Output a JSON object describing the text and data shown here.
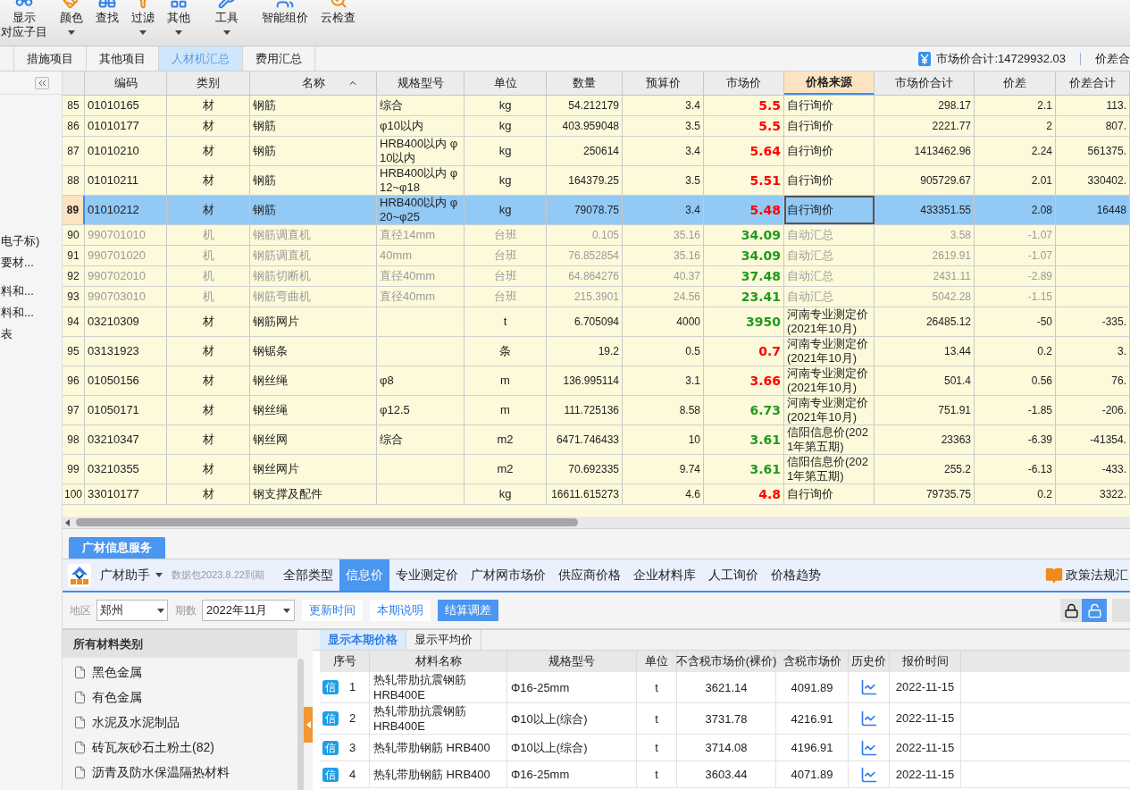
{
  "toolbar": [
    [
      {
        "label": "显示",
        "sublabel": "对应子目",
        "caret": false
      },
      {
        "label": "颜色",
        "caret": true
      },
      {
        "label": "查找",
        "caret": false
      },
      {
        "label": "过滤",
        "caret": true
      },
      {
        "label": "其他",
        "caret": true
      }
    ],
    [
      {
        "label": "工具",
        "caret": true
      }
    ],
    [
      {
        "label": "智能组价",
        "caret": false
      },
      {
        "label": "云检查",
        "caret": false
      }
    ]
  ],
  "sheet_tabs": [
    {
      "label": "措施项目",
      "selected": false
    },
    {
      "label": "其他项目",
      "selected": false
    },
    {
      "label": "人材机汇总",
      "selected": true
    },
    {
      "label": "费用汇总",
      "selected": false
    }
  ],
  "summary": {
    "market_total": "市场价合计:14729932.03",
    "diff_total": "价差合"
  },
  "side_panel": {
    "groups": [
      [
        "电子标)",
        "要材..."
      ],
      [
        "料和...",
        "料和...",
        "表"
      ]
    ]
  },
  "table": {
    "columns": [
      {
        "label": "编码",
        "selected": false,
        "sorted": false
      },
      {
        "label": "类别",
        "selected": false,
        "sorted": false
      },
      {
        "label": "名称",
        "selected": false,
        "sorted": true
      },
      {
        "label": "规格型号",
        "selected": false,
        "sorted": false
      },
      {
        "label": "单位",
        "selected": false,
        "sorted": false
      },
      {
        "label": "数量",
        "selected": false,
        "sorted": false
      },
      {
        "label": "预算价",
        "selected": false,
        "sorted": false
      },
      {
        "label": "市场价",
        "selected": false,
        "sorted": false
      },
      {
        "label": "价格来源",
        "selected": true,
        "sorted": false
      },
      {
        "label": "市场价合计",
        "selected": false,
        "sorted": false
      },
      {
        "label": "价差",
        "selected": false,
        "sorted": false
      },
      {
        "label": "价差合计",
        "selected": false,
        "sorted": false
      }
    ],
    "rows": [
      {
        "no": "85",
        "code": "01010165",
        "type": "材",
        "name": "钢筋",
        "spec": "综合",
        "unit": "kg",
        "qty": "54.212179",
        "budget": "3.4",
        "market": "5.5",
        "color": "#ff0000",
        "source": "自行询价",
        "total": "298.17",
        "diff": "2.1",
        "diff_total": "113.",
        "selected": false,
        "dimmed": false
      },
      {
        "no": "86",
        "code": "01010177",
        "type": "材",
        "name": "钢筋",
        "spec": "φ10以内",
        "unit": "kg",
        "qty": "403.959048",
        "budget": "3.5",
        "market": "5.5",
        "color": "#ff0000",
        "source": "自行询价",
        "total": "2221.77",
        "diff": "2",
        "diff_total": "807.",
        "selected": false,
        "dimmed": false
      },
      {
        "no": "87",
        "code": "01010210",
        "type": "材",
        "name": "钢筋",
        "spec": "HRB400以内 φ10以内",
        "unit": "kg",
        "qty": "250614",
        "budget": "3.4",
        "market": "5.64",
        "color": "#ff0000",
        "source": "自行询价",
        "total": "1413462.96",
        "diff": "2.24",
        "diff_total": "561375.",
        "selected": false,
        "dimmed": false
      },
      {
        "no": "88",
        "code": "01010211",
        "type": "材",
        "name": "钢筋",
        "spec": "HRB400以内 φ12~φ18",
        "unit": "kg",
        "qty": "164379.25",
        "budget": "3.5",
        "market": "5.51",
        "color": "#ff0000",
        "source": "自行询价",
        "total": "905729.67",
        "diff": "2.01",
        "diff_total": "330402.",
        "selected": false,
        "dimmed": false
      },
      {
        "no": "89",
        "code": "01010212",
        "type": "材",
        "name": "钢筋",
        "spec": "HRB400以内 φ20~φ25",
        "unit": "kg",
        "qty": "79078.75",
        "budget": "3.4",
        "market": "5.48",
        "color": "#ff0000",
        "source": "自行询价",
        "total": "433351.55",
        "diff": "2.08",
        "diff_total": "16448",
        "selected": true,
        "dimmed": false
      },
      {
        "no": "90",
        "code": "990701010",
        "type": "机",
        "name": "钢筋调直机",
        "spec": "直径14mm",
        "unit": "台班",
        "qty": "0.105",
        "budget": "35.16",
        "market": "34.09",
        "color": "#1f9a1f",
        "source": "自动汇总",
        "total": "3.58",
        "diff": "-1.07",
        "selected": false,
        "dimmed": true
      },
      {
        "no": "91",
        "code": "990701020",
        "type": "机",
        "name": "钢筋调直机",
        "spec": "40mm",
        "unit": "台班",
        "qty": "76.852854",
        "budget": "35.16",
        "market": "34.09",
        "color": "#1f9a1f",
        "source": "自动汇总",
        "total": "2619.91",
        "diff": "-1.07",
        "selected": false,
        "dimmed": true
      },
      {
        "no": "92",
        "code": "990702010",
        "type": "机",
        "name": "钢筋切断机",
        "spec": "直径40mm",
        "unit": "台班",
        "qty": "64.864276",
        "budget": "40.37",
        "market": "37.48",
        "color": "#1f9a1f",
        "source": "自动汇总",
        "total": "2431.11",
        "diff": "-2.89",
        "selected": false,
        "dimmed": true
      },
      {
        "no": "93",
        "code": "990703010",
        "type": "机",
        "name": "钢筋弯曲机",
        "spec": "直径40mm",
        "unit": "台班",
        "qty": "215.3901",
        "budget": "24.56",
        "market": "23.41",
        "color": "#1f9a1f",
        "source": "自动汇总",
        "total": "5042.28",
        "diff": "-1.15",
        "selected": false,
        "dimmed": true
      },
      {
        "no": "94",
        "code": "03210309",
        "type": "材",
        "name": "钢筋网片",
        "unit": "t",
        "qty": "6.705094",
        "budget": "4000",
        "market": "3950",
        "color": "#1f9a1f",
        "source": "河南专业测定价(2021年10月)",
        "total": "26485.12",
        "diff": "-50",
        "diff_total": "-335.",
        "selected": false,
        "dimmed": false
      },
      {
        "no": "95",
        "code": "03131923",
        "type": "材",
        "name": "钢锯条",
        "unit": "条",
        "qty": "19.2",
        "budget": "0.5",
        "market": "0.7",
        "color": "#ff0000",
        "source": "河南专业测定价(2021年10月)",
        "total": "13.44",
        "diff": "0.2",
        "diff_total": "3.",
        "selected": false,
        "dimmed": false
      },
      {
        "no": "96",
        "code": "01050156",
        "type": "材",
        "name": "钢丝绳",
        "spec": "φ8",
        "unit": "m",
        "qty": "136.995114",
        "budget": "3.1",
        "market": "3.66",
        "color": "#ff0000",
        "source": "河南专业测定价(2021年10月)",
        "total": "501.4",
        "diff": "0.56",
        "diff_total": "76.",
        "selected": false,
        "dimmed": false
      },
      {
        "no": "97",
        "code": "01050171",
        "type": "材",
        "name": "钢丝绳",
        "spec": "φ12.5",
        "unit": "m",
        "qty": "111.725136",
        "budget": "8.58",
        "market": "6.73",
        "color": "#1f9a1f",
        "source": "河南专业测定价(2021年10月)",
        "total": "751.91",
        "diff": "-1.85",
        "diff_total": "-206.",
        "selected": false,
        "dimmed": false
      },
      {
        "no": "98",
        "code": "03210347",
        "type": "材",
        "name": "钢丝网",
        "spec": "综合",
        "unit": "m2",
        "qty": "6471.746433",
        "budget": "10",
        "market": "3.61",
        "color": "#1f9a1f",
        "source": "信阳信息价(2021年第五期)",
        "total": "23363",
        "diff": "-6.39",
        "diff_total": "-41354.",
        "selected": false,
        "dimmed": false
      },
      {
        "no": "99",
        "code": "03210355",
        "type": "材",
        "name": "钢丝网片",
        "unit": "m2",
        "qty": "70.692335",
        "budget": "9.74",
        "market": "3.61",
        "color": "#1f9a1f",
        "source": "信阳信息价(2021年第五期)",
        "total": "255.2",
        "diff": "-6.13",
        "diff_total": "-433.",
        "selected": false,
        "dimmed": false
      },
      {
        "no": "100",
        "code": "33010177",
        "type": "材",
        "name": "钢支撑及配件",
        "unit": "kg",
        "qty": "16611.615273",
        "budget": "4.6",
        "market": "4.8",
        "color": "#ff0000",
        "source": "自行询价",
        "total": "79735.75",
        "diff": "0.2",
        "diff_total": "3322.",
        "selected": false,
        "dimmed": false
      }
    ]
  },
  "service": {
    "tab": "广材信息服务",
    "brand": "广材助手",
    "package": "数据包2023.8.22到期",
    "categories": [
      {
        "label": "全部类型",
        "selected": false
      },
      {
        "label": "信息价",
        "selected": true
      },
      {
        "label": "专业测定价",
        "selected": false
      },
      {
        "label": "广材网市场价",
        "selected": false
      },
      {
        "label": "供应商价格",
        "selected": false
      },
      {
        "label": "企业材料库",
        "selected": false
      },
      {
        "label": "人工询价",
        "selected": false
      },
      {
        "label": "价格趋势",
        "selected": false
      }
    ],
    "policy": "政策法规汇"
  },
  "filters": {
    "region_label": "地区",
    "region": "郑州",
    "period_label": "期数",
    "period": "2022年11月",
    "buttons": [
      {
        "label": "更新时间",
        "primary": false
      },
      {
        "label": "本期说明",
        "primary": false
      },
      {
        "label": "结算调差",
        "primary": true
      }
    ]
  },
  "material_categories": {
    "title": "所有材料类别",
    "items": [
      "黑色金属",
      "有色金属",
      "水泥及水泥制品",
      "砖瓦灰砂石土粉土(82)",
      "沥青及防水保温隔热材料"
    ]
  },
  "price_tabs": [
    {
      "label": "显示本期价格",
      "selected": true
    },
    {
      "label": "显示平均价",
      "selected": false
    }
  ],
  "price_table": {
    "columns": [
      "序号",
      "材料名称",
      "规格型号",
      "单位",
      "不含税市场价(裸价)",
      "含税市场价",
      "历史价",
      "报价时间"
    ],
    "rows": [
      {
        "badge": "信",
        "no": "1",
        "name": "热轧带肋抗震钢筋 HRB400E",
        "spec": "Φ16-25mm",
        "unit": "t",
        "price_ex_tax": "3621.14",
        "price_tax": "4091.89",
        "date": "2022-11-15"
      },
      {
        "badge": "信",
        "no": "2",
        "name": "热轧带肋抗震钢筋 HRB400E",
        "spec": "Φ10以上(综合)",
        "unit": "t",
        "price_ex_tax": "3731.78",
        "price_tax": "4216.91",
        "date": "2022-11-15"
      },
      {
        "badge": "信",
        "no": "3",
        "name": "热轧带肋钢筋 HRB400",
        "spec": "Φ10以上(综合)",
        "unit": "t",
        "price_ex_tax": "3714.08",
        "price_tax": "4196.91",
        "date": "2022-11-15"
      },
      {
        "badge": "信",
        "no": "4",
        "name": "热轧带肋钢筋 HRB400",
        "spec": "Φ16-25mm",
        "unit": "t",
        "price_ex_tax": "3603.44",
        "price_tax": "4071.89",
        "date": "2022-11-15"
      }
    ]
  }
}
